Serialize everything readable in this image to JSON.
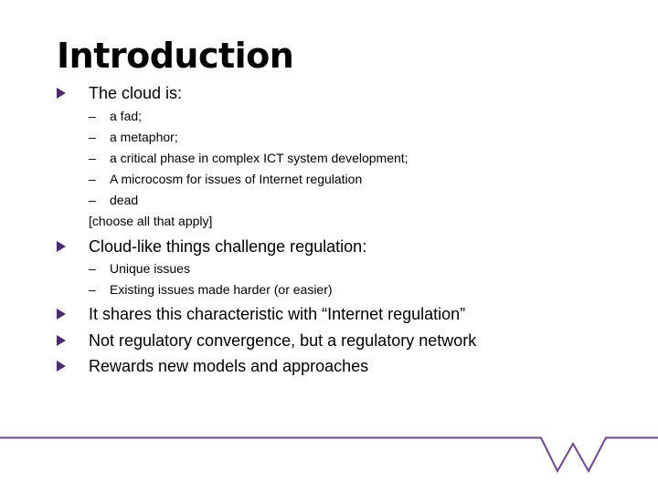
{
  "slide": {
    "title": "Introduction",
    "accent_color": "#6b4a8a",
    "bullets": [
      {
        "text": "The cloud is:",
        "subitems": [
          "a fad;",
          "a metaphor;",
          "a critical phase in complex ICT system development;",
          "A microcosm for issues of Internet regulation",
          "dead"
        ],
        "note": "[choose all that apply]"
      },
      {
        "text": "Cloud-like things challenge regulation:",
        "subitems": [
          "Unique issues",
          "Existing issues made harder (or easier)"
        ]
      },
      {
        "text": "It shares this characteristic with “Internet regulation”"
      },
      {
        "text": "Not regulatory convergence, but a regulatory network"
      },
      {
        "text": "Rewards new models and approaches"
      }
    ],
    "dash": "–"
  }
}
